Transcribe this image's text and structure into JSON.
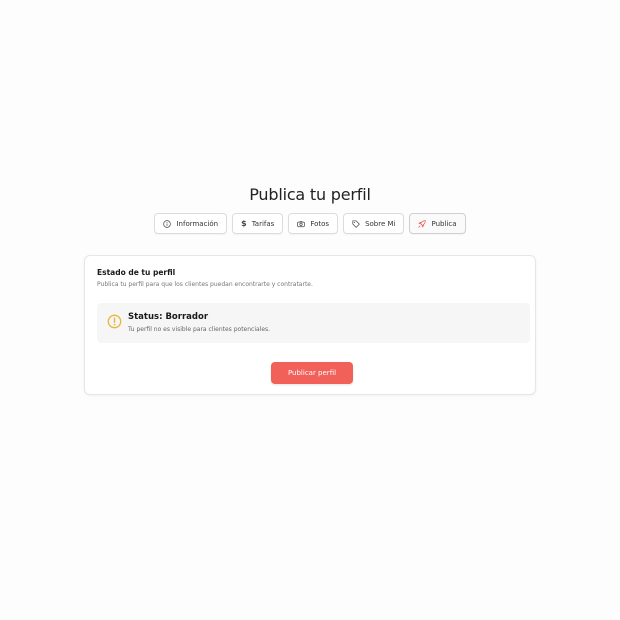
{
  "page": {
    "title": "Publica tu perfil"
  },
  "tabs": [
    {
      "label": "Información",
      "icon": "info-icon"
    },
    {
      "label": "Tarifas",
      "icon": "dollar-icon"
    },
    {
      "label": "Fotos",
      "icon": "camera-icon"
    },
    {
      "label": "Sobre Mi",
      "icon": "tag-icon"
    },
    {
      "label": "Publica",
      "icon": "rocket-icon",
      "active": true
    }
  ],
  "card": {
    "title": "Estado de tu perfil",
    "subtitle": "Publica tu perfil para que los clientes puedan encontrarte y contratarte.",
    "status": {
      "title": "Status: Borrador",
      "description": "Tu perfil no es visible para clientes potenciales.",
      "icon": "warning-circle-icon",
      "icon_color": "#e9b63a"
    },
    "button_label": "Publicar perfil",
    "button_color": "#f2605a"
  },
  "colors": {
    "accent": "#f2605a",
    "rocket": "#e8554e"
  }
}
